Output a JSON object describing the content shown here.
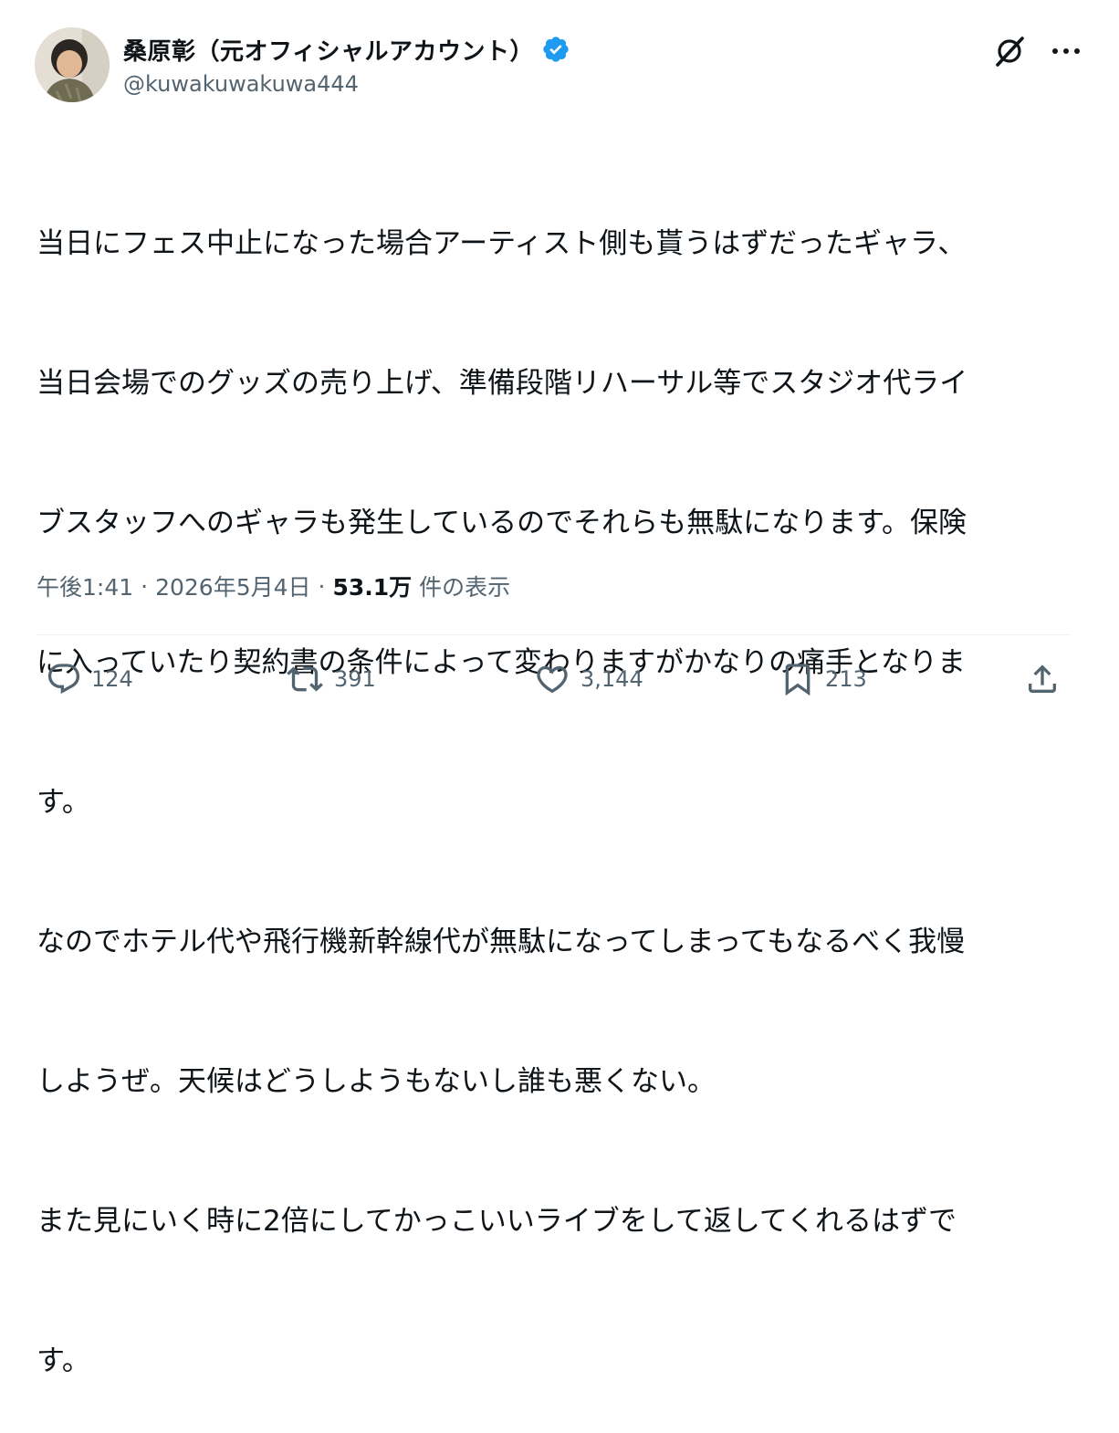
{
  "author": {
    "display_name": "桑原彰（元オフィシャルアカウント）",
    "handle": "@kuwakuwakuwa444",
    "verified": true,
    "verified_color": "#1d9bf0"
  },
  "tweet": {
    "lines": [
      "当日にフェス中止になった場合アーティスト側も貰うはずだったギャラ、",
      "当日会場でのグッズの売り上げ、準備段階リハーサル等でスタジオ代ライ",
      "ブスタッフへのギャラも発生しているのでそれらも無駄になります。保険",
      "に入っていたり契約書の条件によって変わりますがかなりの痛手となりま",
      "す。",
      "なのでホテル代や飛行機新幹線代が無駄になってしまってもなるべく我慢",
      "しようぜ。天候はどうしようもないし誰も悪くない。",
      "また見にいく時に2倍にしてかっこいいライブをして返してくれるはずで",
      "す。"
    ]
  },
  "meta": {
    "time": "午後1:41",
    "separator": "·",
    "date": "2026年5月4日",
    "views_count": "53.1万",
    "views_label": "件の表示"
  },
  "actions": {
    "reply_count": "124",
    "repost_count": "391",
    "like_count": "3,144",
    "bookmark_count": "213"
  },
  "icons": {
    "header": [
      "grok-icon",
      "more-icon"
    ],
    "actions": [
      "reply-icon",
      "repost-icon",
      "like-icon",
      "bookmark-icon",
      "share-icon"
    ]
  },
  "colors": {
    "text_primary": "#0f1419",
    "text_secondary": "#536471",
    "divider": "#eff3f4"
  }
}
